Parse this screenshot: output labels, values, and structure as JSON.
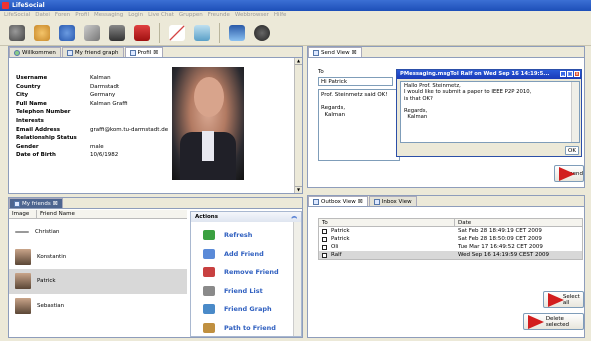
{
  "app": {
    "title": "LifeSocial"
  },
  "menubar": [
    "LifeSocial",
    "Datei",
    "Foren",
    "Profil",
    "Messaging",
    "Login",
    "Live Chat",
    "Gruppen",
    "Freunde",
    "Webbrowser",
    "Hilfe"
  ],
  "toolbar": {
    "icons": [
      "people-icon",
      "network-icon",
      "group-icon",
      "chart-icon",
      "photo-icon",
      "calendar-icon",
      "pen-icon",
      "document-icon",
      "picture-icon",
      "handshake-icon"
    ]
  },
  "left_tabs": [
    "Willkommen",
    "My friend graph",
    "Profil"
  ],
  "profile": {
    "fields": [
      {
        "k": "Username",
        "v": "Kalman"
      },
      {
        "k": "Country",
        "v": "Darmstadt"
      },
      {
        "k": "City",
        "v": "Germany"
      },
      {
        "k": "Full Name",
        "v": "Kalman Graffi"
      },
      {
        "k": "Telephon Number",
        "v": ""
      },
      {
        "k": "Interests",
        "v": ""
      },
      {
        "k": "Email Address",
        "v": "graffi@kom.tu-darmstadt.de"
      },
      {
        "k": "Relationship Status",
        "v": ""
      },
      {
        "k": "Gender",
        "v": "male"
      },
      {
        "k": "Date of Birth",
        "v": "10/6/1982"
      }
    ]
  },
  "send_view": {
    "tab": "Send View",
    "to_label": "To",
    "to_value": "Hi Patrick",
    "body": "Prof. Steinmetz said OK!\n\nRegards,\n  Kalman",
    "send_label": "send"
  },
  "popup": {
    "title": "PMessaging.msgToI Ralf on Wed Sep 16 14:19:5...",
    "body": "Hallo Prof. Steinmetz,\nI would like to submit a paper to IEEE P2P 2010,\nis that OK?\n\nRegards,\n  Kalman",
    "ok_label": "OK"
  },
  "friends_panel": {
    "tab": "My friends",
    "col_image": "Image",
    "col_name": "Friend Name",
    "friends": [
      "Christian",
      "Konstantin",
      "Patrick",
      "Sebastian"
    ]
  },
  "actions": {
    "title": "Actions",
    "items": [
      "Refresh",
      "Add Friend",
      "Remove Friend",
      "Friend List",
      "Friend Graph",
      "Path to Friend"
    ],
    "colors": [
      "#3aa040",
      "#5a8ad8",
      "#c84040",
      "#8a8a8a",
      "#4a8ac8",
      "#c09040"
    ]
  },
  "outbox": {
    "tabs": [
      "Outbox View",
      "Inbox View"
    ],
    "col_to": "To",
    "col_date": "Date",
    "rows": [
      {
        "to": "Patrick",
        "date": "Sat Feb 28 18:49:19 CET 2009"
      },
      {
        "to": "Patrick",
        "date": "Sat Feb 28 18:50:09 CET 2009"
      },
      {
        "to": "Oli",
        "date": "Tue Mar 17 16:49:52 CET 2009"
      },
      {
        "to": "Ralf",
        "date": "Wed Sep 16 14:19:59 CEST 2009"
      }
    ],
    "select_all": "Select all",
    "delete_selected": "Delete selected"
  }
}
